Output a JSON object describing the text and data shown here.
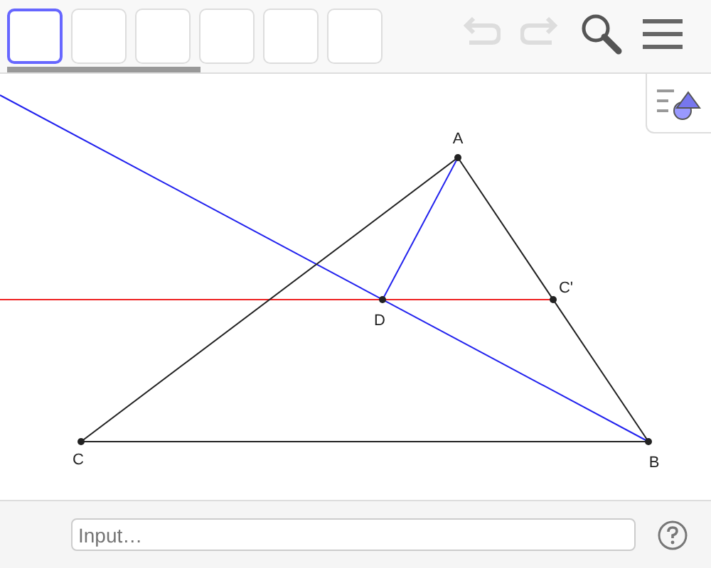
{
  "toolbar": {
    "tools": [
      {
        "selected": true
      },
      {
        "selected": false
      },
      {
        "selected": false
      },
      {
        "selected": false
      },
      {
        "selected": false
      },
      {
        "selected": false
      }
    ],
    "undo": {
      "disabled": true
    },
    "redo": {
      "disabled": true
    }
  },
  "graphics": {
    "points": [
      {
        "label": "A"
      },
      {
        "label": "B"
      },
      {
        "label": "C"
      },
      {
        "label": "D"
      },
      {
        "label": "C'"
      }
    ]
  },
  "input_bar": {
    "placeholder": "Input…"
  }
}
